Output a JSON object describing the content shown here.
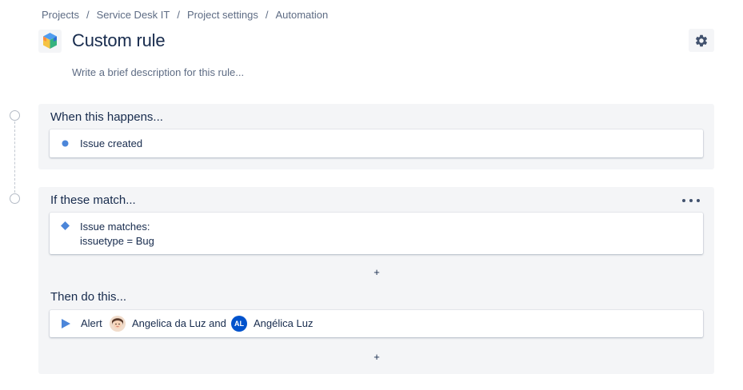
{
  "breadcrumb": {
    "items": [
      "Projects",
      "Service Desk IT",
      "Project settings",
      "Automation"
    ],
    "separator": "/"
  },
  "header": {
    "title": "Custom rule",
    "description_placeholder": "Write a brief description for this rule...",
    "settings_icon": "gear-icon",
    "project_icon": "project-cube-icon"
  },
  "trigger": {
    "title": "When this happens...",
    "card": {
      "label": "Issue created",
      "icon": "circle-dot-icon"
    }
  },
  "condition": {
    "title": "If these match...",
    "more_icon": "more-horizontal-icon",
    "card": {
      "line1": "Issue matches:",
      "line2": "issuetype = Bug",
      "icon": "diamond-icon"
    },
    "add_label": "+"
  },
  "action": {
    "title": "Then do this...",
    "card": {
      "verb": "Alert",
      "user1": "Angelica da Luz and",
      "user2_initials": "AL",
      "user2": "Angélica Luz",
      "icon": "play-icon"
    },
    "add_label": "+"
  },
  "colors": {
    "accent": "#4c86d9",
    "section_bg": "#f4f5f7",
    "text": "#172b4d",
    "muted": "#5e6c84",
    "avatar_blue": "#0052cc"
  }
}
